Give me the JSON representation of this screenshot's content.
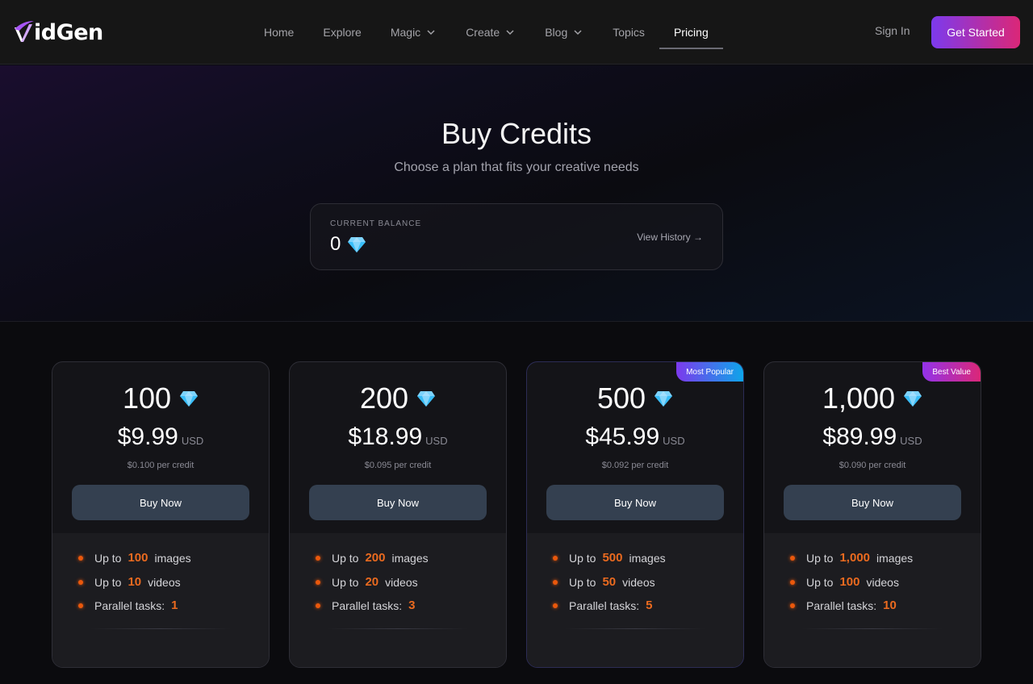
{
  "brand": {
    "name": "idGen",
    "logo_letter": "V"
  },
  "nav": {
    "items": [
      {
        "label": "Home",
        "dropdown": false,
        "active": false
      },
      {
        "label": "Explore",
        "dropdown": false,
        "active": false
      },
      {
        "label": "Magic",
        "dropdown": true,
        "active": false
      },
      {
        "label": "Create",
        "dropdown": true,
        "active": false
      },
      {
        "label": "Blog",
        "dropdown": true,
        "active": false
      },
      {
        "label": "Topics",
        "dropdown": false,
        "active": false
      },
      {
        "label": "Pricing",
        "dropdown": false,
        "active": true
      }
    ],
    "sign_in": "Sign In",
    "get_started": "Get Started"
  },
  "hero": {
    "title": "Buy Credits",
    "subtitle": "Choose a plan that fits your creative needs",
    "balance_label": "CURRENT BALANCE",
    "balance_value": "0",
    "view_history": "View History →"
  },
  "colors": {
    "accent_start": "#7c3aed",
    "accent_end": "#db2777",
    "highlight": "#ea580c",
    "gem": "#38bdf8"
  },
  "plans": [
    {
      "credits": "100",
      "price": "$9.99",
      "currency": "USD",
      "per_credit": "$0.100 per credit",
      "button": "Buy Now",
      "badge": "",
      "features": {
        "images_prefix": "Up to",
        "images": "100",
        "images_suffix": "images",
        "videos_prefix": "Up to",
        "videos": "10",
        "videos_suffix": "videos",
        "tasks_label": "Parallel tasks:",
        "tasks": "1"
      }
    },
    {
      "credits": "200",
      "price": "$18.99",
      "currency": "USD",
      "per_credit": "$0.095 per credit",
      "button": "Buy Now",
      "badge": "",
      "features": {
        "images_prefix": "Up to",
        "images": "200",
        "images_suffix": "images",
        "videos_prefix": "Up to",
        "videos": "20",
        "videos_suffix": "videos",
        "tasks_label": "Parallel tasks:",
        "tasks": "3"
      }
    },
    {
      "credits": "500",
      "price": "$45.99",
      "currency": "USD",
      "per_credit": "$0.092 per credit",
      "button": "Buy Now",
      "badge": "Most Popular",
      "features": {
        "images_prefix": "Up to",
        "images": "500",
        "images_suffix": "images",
        "videos_prefix": "Up to",
        "videos": "50",
        "videos_suffix": "videos",
        "tasks_label": "Parallel tasks:",
        "tasks": "5"
      }
    },
    {
      "credits": "1,000",
      "price": "$89.99",
      "currency": "USD",
      "per_credit": "$0.090 per credit",
      "button": "Buy Now",
      "badge": "Best Value",
      "features": {
        "images_prefix": "Up to",
        "images": "1,000",
        "images_suffix": "images",
        "videos_prefix": "Up to",
        "videos": "100",
        "videos_suffix": "videos",
        "tasks_label": "Parallel tasks:",
        "tasks": "10"
      }
    }
  ]
}
